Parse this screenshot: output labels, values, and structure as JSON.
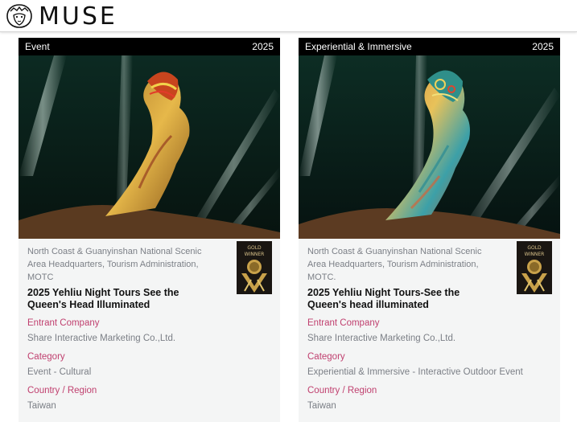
{
  "brand": {
    "name": "MUSE"
  },
  "cards": [
    {
      "category_tag": "Event",
      "year": "2025",
      "organization": "North Coast & Guanyinshan National Scenic Area Headquarters, Tourism Administration, MOTC",
      "title": "2025 Yehliu Night Tours See the Queen's Head Illuminated",
      "badge_line1": "GOLD",
      "badge_line2": "WINNER",
      "entrant_label": "Entrant Company",
      "entrant_value": "Share Interactive Marketing Co.,Ltd.",
      "category_label": "Category",
      "category_value": "Event - Cultural",
      "country_label": "Country / Region",
      "country_value": "Taiwan"
    },
    {
      "category_tag": "Experiential & Immersive",
      "year": "2025",
      "organization": "North Coast & Guanyinshan National Scenic Area Headquarters, Tourism Administration, MOTC.",
      "title": "2025 Yehliu Night Tours-See the Queen's head illuminated",
      "badge_line1": "GOLD",
      "badge_line2": "WINNER",
      "entrant_label": "Entrant Company",
      "entrant_value": "Share Interactive Marketing Co.,Ltd.",
      "category_label": "Category",
      "category_value": "Experiential & Immersive - Interactive Outdoor Event",
      "country_label": "Country / Region",
      "country_value": "Taiwan"
    }
  ],
  "colors": {
    "accent_label": "#c0406f",
    "badge_gold": "#c9a24a",
    "card_header": "#000000"
  }
}
